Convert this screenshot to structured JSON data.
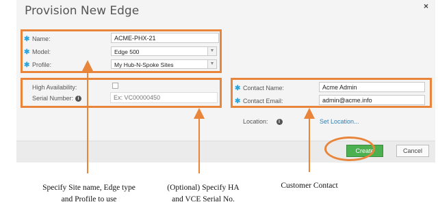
{
  "dialog": {
    "title": "Provision New Edge",
    "close_symbol": "×",
    "colors": {
      "accent_box": "#e8853a",
      "required_star": "#2aa5dd",
      "create_button": "#4caf50",
      "link": "#2f7fb2"
    }
  },
  "form": {
    "required_marker": "✱",
    "name": {
      "label": "Name:",
      "value": "ACME-PHX-21"
    },
    "model": {
      "label": "Model:",
      "value": "Edge 500"
    },
    "profile": {
      "label": "Profile:",
      "value": "My Hub-N-Spoke Sites"
    },
    "high_availability": {
      "label": "High Availability:",
      "checked": false
    },
    "serial_number": {
      "label": "Serial Number:",
      "placeholder": "Ex: VC00000450",
      "info_icon": "info-icon"
    },
    "contact_name": {
      "label": "Contact Name:",
      "value": "Acme Admin"
    },
    "contact_email": {
      "label": "Contact Email:",
      "value": "admin@acme.info"
    },
    "location": {
      "label": "Location:",
      "link": "Set Location...",
      "info_icon": "info-icon"
    }
  },
  "buttons": {
    "create": "Create",
    "cancel": "Cancel"
  },
  "captions": {
    "site": [
      "Specify Site name, Edge type",
      "and Profile to use"
    ],
    "ha": [
      "(Optional) Specify HA",
      "and VCE Serial No."
    ],
    "contact": [
      "Customer Contact"
    ]
  }
}
